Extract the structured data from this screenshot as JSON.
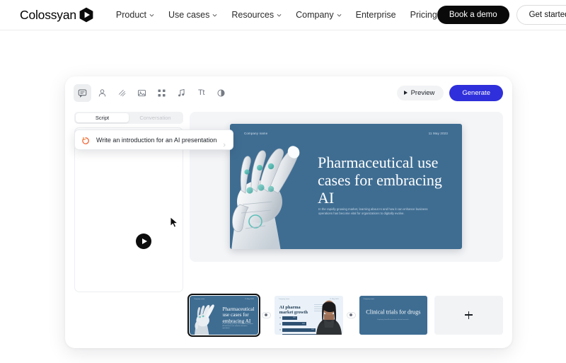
{
  "topnav": {
    "logo_text": "Colossyan",
    "logo_icon": "hexagon-play-icon",
    "items": [
      {
        "label": "Product",
        "has_chevron": true
      },
      {
        "label": "Use cases",
        "has_chevron": true
      },
      {
        "label": "Resources",
        "has_chevron": true
      },
      {
        "label": "Company",
        "has_chevron": true
      },
      {
        "label": "Enterprise",
        "has_chevron": false
      },
      {
        "label": "Pricing",
        "has_chevron": false
      }
    ],
    "book_demo_label": "Book a demo",
    "get_started_label": "Get started"
  },
  "app": {
    "toolbar": {
      "tools": [
        {
          "name": "script-icon",
          "active": true
        },
        {
          "name": "avatar-icon",
          "active": false
        },
        {
          "name": "effects-icon",
          "active": false
        },
        {
          "name": "image-icon",
          "active": false
        },
        {
          "name": "apps-grid-icon",
          "active": false
        },
        {
          "name": "music-icon",
          "active": false
        },
        {
          "name": "text-icon",
          "active": false,
          "glyph": "Tt"
        },
        {
          "name": "shapes-icon",
          "active": false
        }
      ],
      "preview_label": "Preview",
      "generate_label": "Generate"
    },
    "script_panel": {
      "tabs": [
        {
          "label": "Script",
          "active": true
        },
        {
          "label": "Conversation",
          "active": false
        }
      ],
      "suggestion": {
        "icon": "ai-sparkle-icon",
        "text": "Write an introduction for an AI presentation"
      }
    },
    "stage": {
      "play_button": "play-icon",
      "slide": {
        "company_name": "Company name",
        "date": "11 May 2023",
        "title": "Pharmaceutical use cases for embracing AI",
        "subtitle": "In the rapidly growing market, learning about AI and how it can enhance business operations has become vital for organizations to digitally evolve.",
        "background_color": "#3f6d92"
      }
    },
    "thumbnails": [
      {
        "index": 1,
        "selected": true,
        "company_name": "Company name",
        "date": "11 May 2023",
        "title": "Pharmaceutical use cases for embracing AI",
        "subtitle": "In the rapidly growing market, learning about AI and how it can enhance business operations."
      },
      {
        "index": 2,
        "selected": false,
        "company_name": "Company name",
        "date": "11 May 2023",
        "title": "AI pharma market growth",
        "bars": [
          {
            "label": "2021",
            "width_pct": 34
          },
          {
            "label": "2022",
            "width_pct": 55
          },
          {
            "label": "2023",
            "width_pct": 76
          },
          {
            "label": "2024",
            "width_pct": 96
          }
        ]
      },
      {
        "index": 3,
        "selected": false,
        "company_name": "Company name",
        "title": "Clinical trials for drugs",
        "subtitle": "Exploring how AI accelerates clinical research."
      }
    ],
    "add_slide_label": "+",
    "colors": {
      "generate_button": "#2f2fdb",
      "slide_blue": "#3f6d92",
      "selection_outline": "#0d0d0d"
    }
  }
}
